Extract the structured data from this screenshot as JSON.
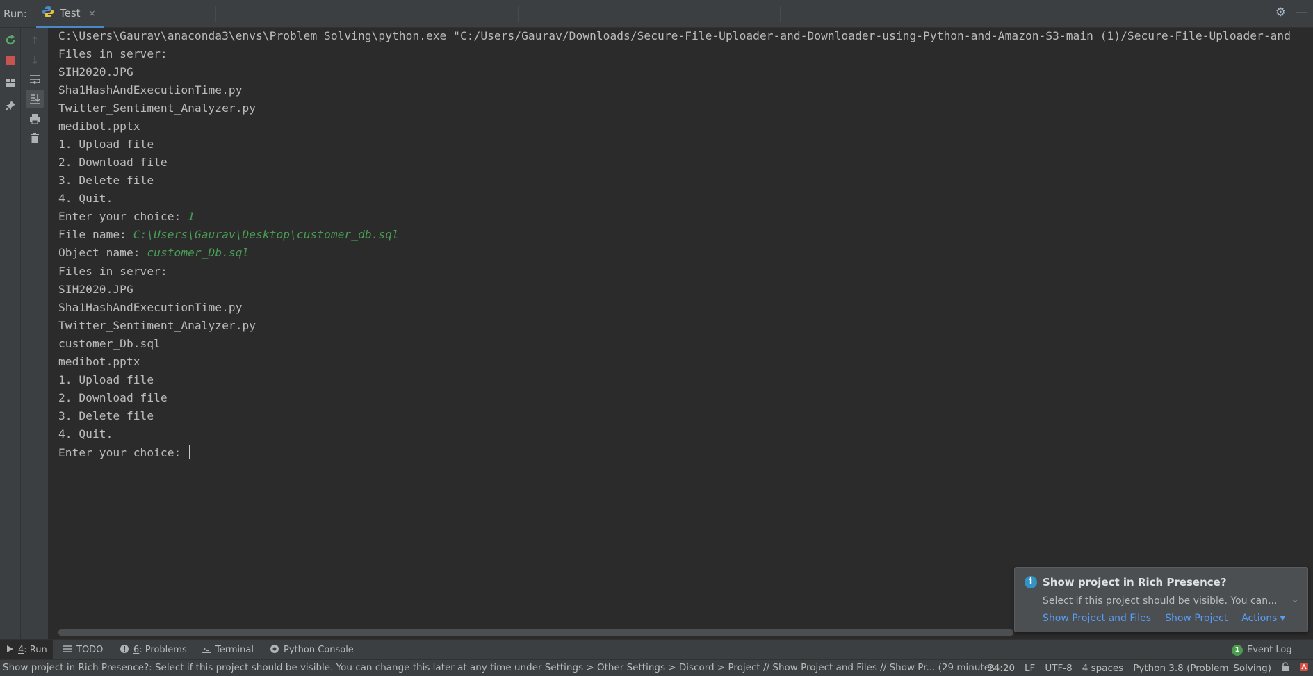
{
  "run_bar": {
    "label": "Run:",
    "tab": {
      "label": "Test",
      "close": "×"
    },
    "settings_icon": "gear-icon",
    "minimize_icon": "minimize-icon"
  },
  "console": {
    "lines": [
      {
        "text": "C:\\Users\\Gaurav\\anaconda3\\envs\\Problem_Solving\\python.exe \"C:/Users/Gaurav/Downloads/Secure-File-Uploader-and-Downloader-using-Python-and-Amazon-S3-main (1)/Secure-File-Uploader-and"
      },
      {
        "text": "Files in server:"
      },
      {
        "text": "SIH2020.JPG"
      },
      {
        "text": "Sha1HashAndExecutionTime.py"
      },
      {
        "text": "Twitter_Sentiment_Analyzer.py"
      },
      {
        "text": "medibot.pptx"
      },
      {
        "text": "1. Upload file"
      },
      {
        "text": "2. Download file"
      },
      {
        "text": "3. Delete file"
      },
      {
        "text": "4. Quit."
      },
      {
        "text": "Enter your choice: ",
        "input": "1"
      },
      {
        "text": "File name: ",
        "input": "C:\\Users\\Gaurav\\Desktop\\customer_db.sql"
      },
      {
        "text": "Object name: ",
        "input": "customer_Db.sql"
      },
      {
        "text": "Files in server:"
      },
      {
        "text": "SIH2020.JPG"
      },
      {
        "text": "Sha1HashAndExecutionTime.py"
      },
      {
        "text": "Twitter_Sentiment_Analyzer.py"
      },
      {
        "text": "customer_Db.sql"
      },
      {
        "text": "medibot.pptx"
      },
      {
        "text": "1. Upload file"
      },
      {
        "text": "2. Download file"
      },
      {
        "text": "3. Delete file"
      },
      {
        "text": "4. Quit."
      },
      {
        "text": "Enter your choice: ",
        "caret": true
      }
    ]
  },
  "notification": {
    "title": "Show project in Rich Presence?",
    "message": "Select if this project should be visible. You can...",
    "actions": [
      "Show Project and Files",
      "Show Project",
      "Actions ▾"
    ]
  },
  "tool_windows": {
    "run": {
      "num": "4",
      "label": ": Run"
    },
    "todo": {
      "label": "TODO"
    },
    "problems": {
      "num": "6",
      "label": ": Problems"
    },
    "terminal": {
      "label": "Terminal"
    },
    "python_console": {
      "label": "Python Console"
    },
    "event_log": {
      "count": "1",
      "label": "Event Log"
    }
  },
  "status_bar": {
    "message": "Show project in Rich Presence?: Select if this project should be visible. You can change this later at any time under Settings > Other Settings > Discord > Project // Show Project and Files // Show Pr... (29 minutes",
    "position": "24:20",
    "line_sep": "LF",
    "encoding": "UTF-8",
    "indent": "4 spaces",
    "interpreter": "Python 3.8 (Problem_Solving)"
  }
}
